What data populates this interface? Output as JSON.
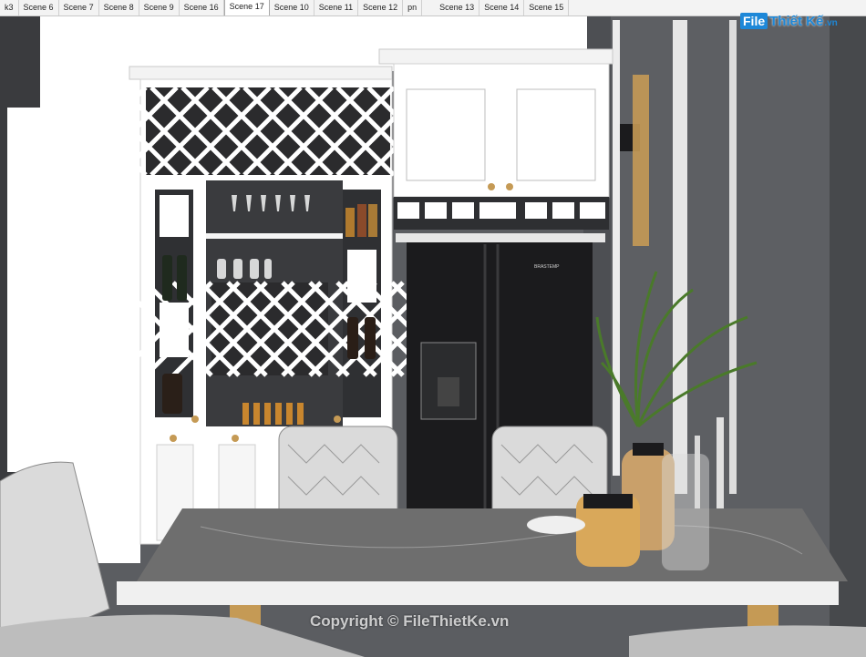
{
  "tabs": [
    {
      "label": "k3",
      "active": false
    },
    {
      "label": "Scene 6",
      "active": false
    },
    {
      "label": "Scene 7",
      "active": false
    },
    {
      "label": "Scene 8",
      "active": false
    },
    {
      "label": "Scene 9",
      "active": false
    },
    {
      "label": "Scene 16",
      "active": false
    },
    {
      "label": "Scene 17",
      "active": true
    },
    {
      "label": "Scene 10",
      "active": false
    },
    {
      "label": "Scene 11",
      "active": false
    },
    {
      "label": "Scene 12",
      "active": false
    },
    {
      "label": "pn",
      "active": false
    },
    {
      "label": "Scene 13",
      "active": false
    },
    {
      "label": "Scene 14",
      "active": false
    },
    {
      "label": "Scene 15",
      "active": false
    }
  ],
  "branding": {
    "logo_mark": "File",
    "logo_text": "Thiết Kế",
    "logo_suffix": ".vn",
    "watermark": "Copyright © FileThietKe.vn",
    "fridge_brand": "BRASTEMP"
  },
  "colors": {
    "wall": "#5a5c60",
    "cabinet": "#ffffff",
    "fridge": "#1b1b1d",
    "marble": "#6d6d6d",
    "gold": "#c59a55",
    "plant": "#4a7a2a",
    "brand_blue": "#1e88d8"
  }
}
